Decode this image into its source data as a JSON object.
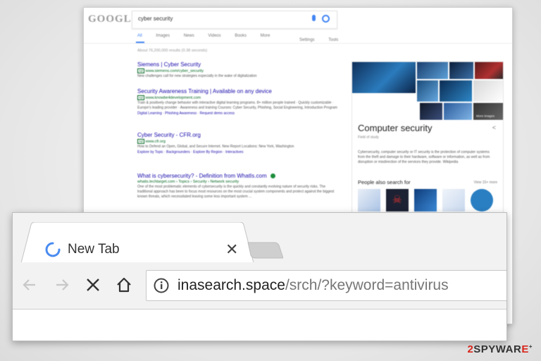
{
  "serp": {
    "logo": "GOOGLE",
    "query": "cyber security",
    "tabs": [
      "All",
      "Images",
      "News",
      "Videos",
      "Books",
      "More"
    ],
    "tabs_right": [
      "Settings",
      "Tools"
    ],
    "stats": "About 76,200,000 results (0.38 seconds)",
    "results": [
      {
        "title": "Siemens | Cyber Security",
        "url": "www.siemens.com/cyber_security",
        "desc": "New challenges call for new strategies especially in the wake of digitalization"
      },
      {
        "title": "Security Awareness Training | Available on any device",
        "url": "www.knowbe4development.com",
        "desc": "Train & positively change behavior with interactive digital learning programs. 8+ million people trained · Quickly customizable · Europe's leading provider · Awareness and training Courses: Cyber Security, Phishing, Social Engineering, Introduction Program",
        "links": "Digital Learning · Phishing Awareness · Request demo access"
      },
      {
        "title": "Cyber Security - CFR.org",
        "url": "www.cfr.org",
        "desc": "How to Defend an Open, Global, and Secure Internet. New Report Locations: New York, Washington",
        "links": "Explore by Topic · Backgrounders · Explore By Region · Interactives"
      },
      {
        "title": "What is cybersecurity? - Definition from WhatIs.com",
        "url": "whatis.techtarget.com › Topics › Security › Network security",
        "desc": "One of the most problematic elements of cybersecurity is the quickly and constantly evolving nature of security risks. The traditional approach has been to focus most resources on the most crucial system components and protect against the biggest known threats, which necessitated leaving some less important system ..."
      }
    ],
    "knowledge_panel": {
      "title": "Computer security",
      "subtitle": "Field of study",
      "description": "Cybersecurity, computer security or IT security is the protection of computer systems from the theft and damage to their hardware, software or information, as well as from disruption or misdirection of the services they provide. Wikipedia",
      "people_also_search": "People also search for",
      "view_more": "View 15+ more",
      "more_images": "More images"
    }
  },
  "browser": {
    "tab_title": "New Tab",
    "url_host": "inasearch.space",
    "url_path": "/srch/?keyword=antivirus"
  },
  "watermark": {
    "num": "2",
    "brand": "SPYWAR",
    "brand_end": "E",
    "sup": "+"
  },
  "colors": {
    "spinner": "#4a8cf0",
    "watermark_red": "#d9261c",
    "link": "#1a0dab",
    "url_green": "#006621"
  }
}
